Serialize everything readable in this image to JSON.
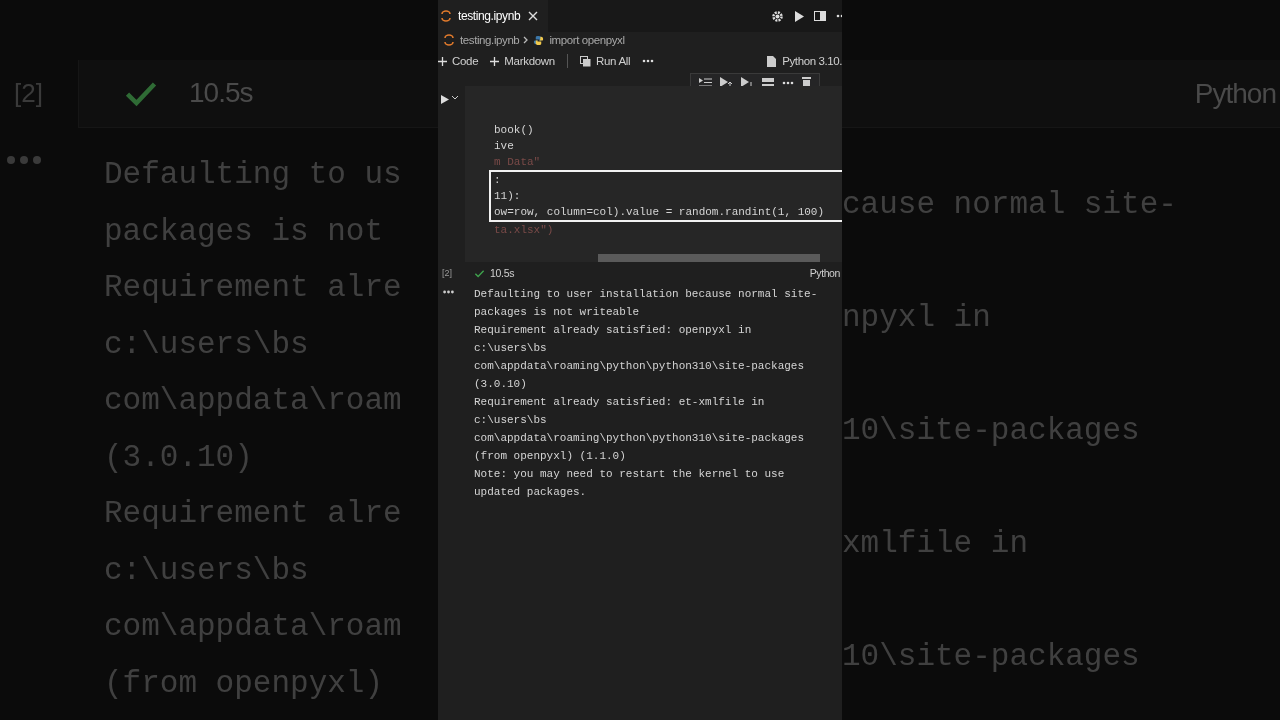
{
  "backdrop": {
    "left": {
      "execution_count": "[2]",
      "succeeded": true,
      "duration": "10.5s",
      "output_lines": [
        "Defaulting to us",
        "packages is not",
        "Requirement alre",
        "c:\\users\\bs",
        "com\\appdata\\roam",
        "(3.0.10)",
        "Requirement alre",
        "c:\\users\\bs",
        "com\\appdata\\roam",
        "(from openpyxl)"
      ]
    },
    "right": {
      "language": "Python",
      "output_lines": [
        "cause normal site-",
        "npyxl in",
        "10\\site-packages",
        "xmlfile in",
        "10\\site-packages"
      ]
    }
  },
  "editor": {
    "tabs": [
      {
        "title": "testing.ipynb",
        "selected": true
      }
    ],
    "breadcrumb": [
      "testing.ipynb",
      "import openpyxl"
    ],
    "toolbar": [
      {
        "kind": "add",
        "label": "Code"
      },
      {
        "kind": "add",
        "label": "Markdown"
      },
      {
        "kind": "run",
        "label": "Run All"
      }
    ],
    "kernel": "Python 3.10.",
    "cell": {
      "code_lines": [
        {
          "text": "book()",
          "faded": false,
          "highlighted": false
        },
        {
          "text": "ive",
          "faded": false,
          "highlighted": false
        },
        {
          "text": "m Data\"",
          "faded": true,
          "highlighted": false
        },
        {
          "text": ":",
          "faded": false,
          "highlighted": true
        },
        {
          "text": "11):",
          "faded": false,
          "highlighted": true
        },
        {
          "text": "ow=row, column=col).value = random.randint(1, 100)",
          "faded": false,
          "highlighted": true
        },
        {
          "text": "ta.xlsx\")",
          "faded": true,
          "highlighted": false
        }
      ],
      "execution_count": "[2]",
      "succeeded": true,
      "duration": "10.5s",
      "language": "Python",
      "output_lines": [
        "Defaulting to user installation because normal site-",
        "packages is not writeable",
        "Requirement already satisfied: openpyxl in",
        "c:\\users\\bs",
        "com\\appdata\\roaming\\python\\python310\\site-packages",
        "(3.0.10)",
        "Requirement already satisfied: et-xmlfile in",
        "c:\\users\\bs",
        "com\\appdata\\roaming\\python\\python310\\site-packages",
        "(from openpyxl) (1.1.0)",
        "Note: you may need to restart the kernel to use",
        "updated packages."
      ]
    }
  }
}
